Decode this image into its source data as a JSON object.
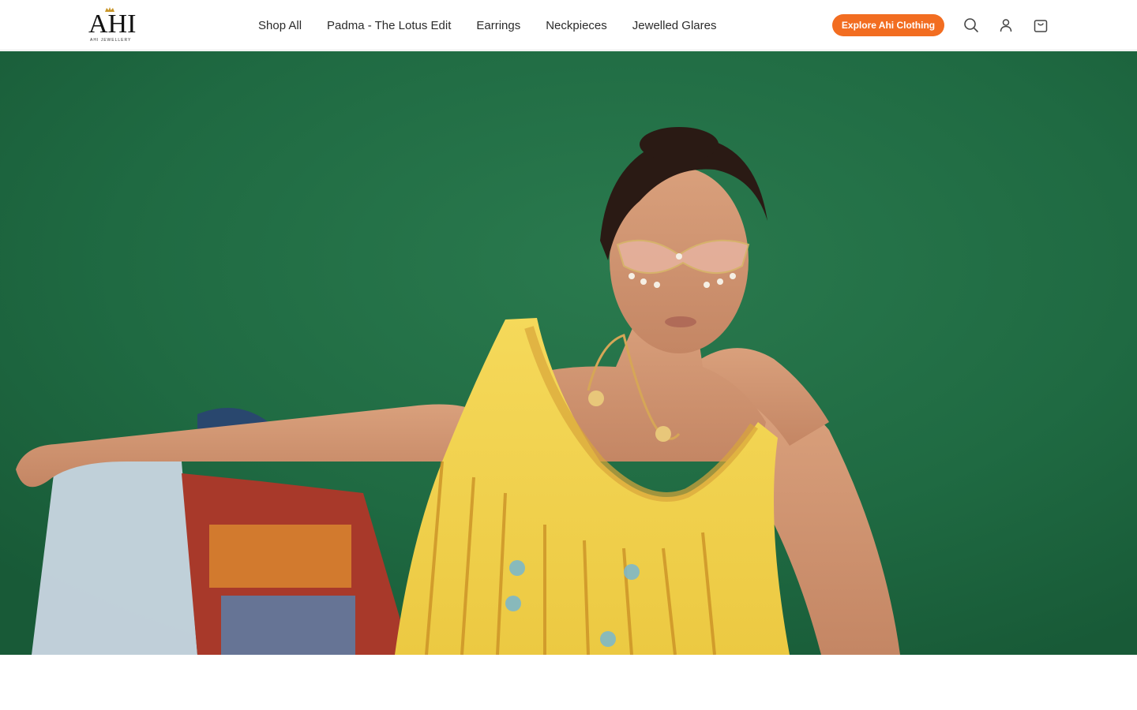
{
  "brand": {
    "logo_text": "AHI",
    "logo_subtext": "AHI JEWELLERY"
  },
  "nav": {
    "items": [
      {
        "label": "Shop All"
      },
      {
        "label": "Padma - The Lotus Edit"
      },
      {
        "label": "Earrings"
      },
      {
        "label": "Neckpieces"
      },
      {
        "label": "Jewelled Glares"
      }
    ]
  },
  "header_actions": {
    "cta_label": "Explore Ahi Clothing",
    "icons": [
      "search-icon",
      "account-icon",
      "cart-icon"
    ]
  },
  "hero": {
    "image": "model-in-yellow-embroidered-outfit-wearing-jewelled-glasses-and-neckpiece"
  },
  "colors": {
    "accent": "#f26d21",
    "hero_background": "#1f6b43",
    "outfit": "#f2d24e"
  }
}
